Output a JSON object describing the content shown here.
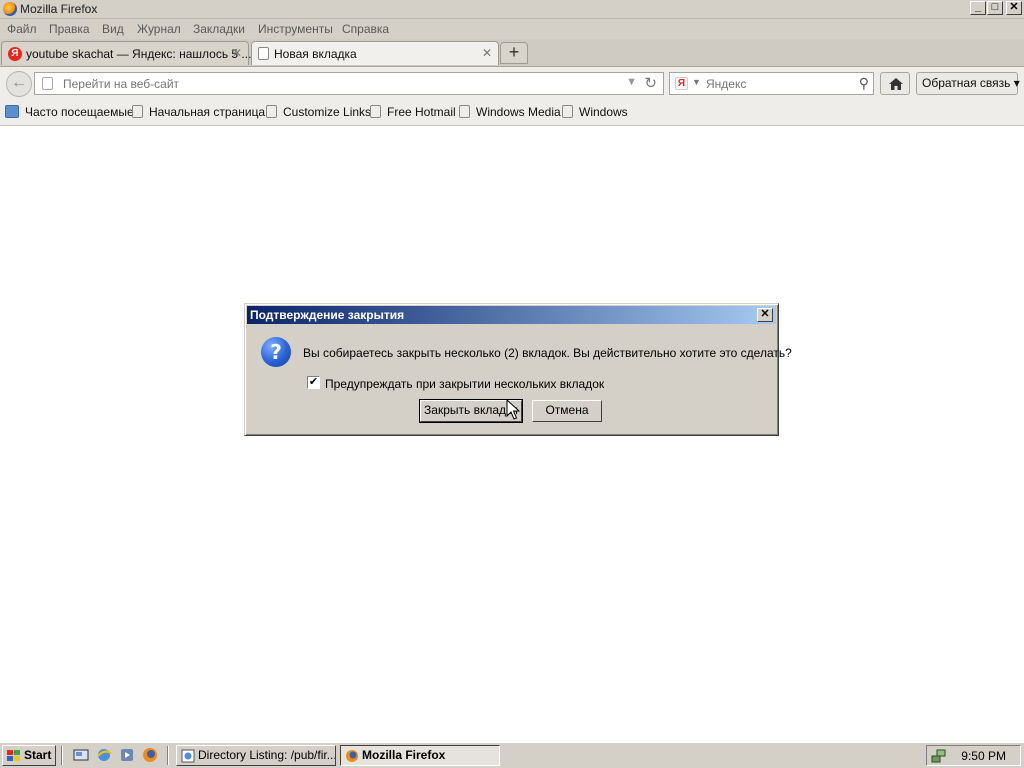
{
  "window": {
    "title": "Mozilla Firefox",
    "controls": {
      "minimize": "_",
      "maximize": "□",
      "close": "✕"
    }
  },
  "menu": [
    "Файл",
    "Правка",
    "Вид",
    "Журнал",
    "Закладки",
    "Инструменты",
    "Справка"
  ],
  "tabs": [
    {
      "label": "youtube skachat — Яндекс: нашлось 5 ...",
      "favicon": "yandex-icon",
      "active": false
    },
    {
      "label": "Новая вкладка",
      "favicon": "blank-page-icon",
      "active": true
    }
  ],
  "tab_close_glyph": "✕",
  "new_tab_glyph": "+",
  "navbar": {
    "back_glyph": "←",
    "url_placeholder": "Перейти на веб-сайт",
    "url_dropmarker": "▼",
    "reload_glyph": "↻",
    "search_engine_letter": "Я",
    "search_dropmarker": "▼",
    "search_placeholder": "Яндекс",
    "search_glyph": "⚲",
    "feedback_label": "Обратная связь ▾"
  },
  "bookmarks": [
    {
      "label": "Часто посещаемые",
      "icon": "most-visited-icon"
    },
    {
      "label": "Начальная страница",
      "icon": "blank-page-icon"
    },
    {
      "label": "Customize Links",
      "icon": "blank-page-icon"
    },
    {
      "label": "Free Hotmail",
      "icon": "blank-page-icon"
    },
    {
      "label": "Windows Media",
      "icon": "blank-page-icon"
    },
    {
      "label": "Windows",
      "icon": "blank-page-icon"
    }
  ],
  "dialog": {
    "title": "Подтверждение закрытия",
    "close_glyph": "✕",
    "icon_glyph": "?",
    "message": "Вы собираетесь закрыть несколько (2) вкладок. Вы действительно хотите это сделать?",
    "checkbox_label": "Предупреждать при закрытии нескольких вкладок",
    "checkbox_checked": true,
    "checkbox_glyph": "✔",
    "confirm_label": "Закрыть вкладки",
    "cancel_label": "Отмена"
  },
  "taskbar": {
    "start_label": "Start",
    "tasks": [
      {
        "label": "Directory Listing: /pub/fir...",
        "icon": "ie-page-icon",
        "active": false
      },
      {
        "label": "Mozilla Firefox",
        "icon": "firefox-icon",
        "active": true
      }
    ],
    "clock": "9:50 PM"
  },
  "colors": {
    "dialog_title_start": "#0a246a",
    "dialog_title_end": "#a6caf0",
    "chrome_gray": "#d4d0c8",
    "yandex_red": "#e8261c"
  }
}
